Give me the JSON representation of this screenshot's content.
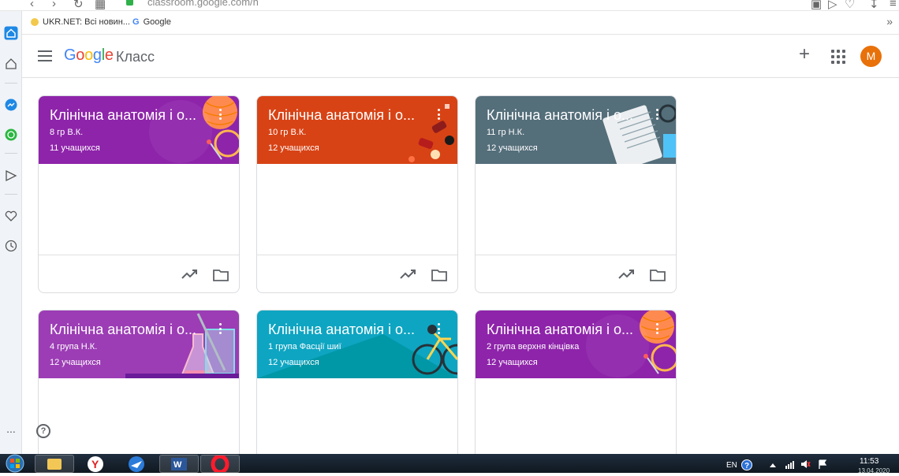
{
  "browser": {
    "url": "classroom.google.com/h",
    "bookmarks": [
      {
        "label": "UKR.NET: Всі новин...",
        "icon": "ukrnet-icon"
      },
      {
        "label": "Google",
        "icon": "google-g-icon"
      }
    ],
    "bookmarks_more": "»"
  },
  "header": {
    "logo_parts": [
      "G",
      "o",
      "o",
      "g",
      "l",
      "e"
    ],
    "app_name": "Класс",
    "avatar_letter": "M",
    "plus_label": "+"
  },
  "courses": [
    {
      "title": "Клінічна анатомія і о...",
      "section": "8 гр В.К.",
      "students": "11 учащихся",
      "color": "#8e24aa",
      "theme": "ball-yarn"
    },
    {
      "title": "Клінічна анатомія і о...",
      "section": "10 гр В.К.",
      "students": "12 учащихся",
      "color": "#d84315",
      "theme": "party"
    },
    {
      "title": "Клінічна анатомія і о...",
      "section": "11 гр Н.К.",
      "students": "12 учащихся",
      "color": "#546e7a",
      "theme": "notebook"
    },
    {
      "title": "Клінічна анатомія і о...",
      "section": "4 група Н.К.",
      "students": "12 учащихся",
      "color": "#9c3db5",
      "theme": "chemistry"
    },
    {
      "title": "Клінічна анатомія і о...",
      "section": "1 група Фасції шиї",
      "students": "12 учащихся",
      "color": "#0ea5c2",
      "theme": "bicycle"
    },
    {
      "title": "Клінічна анатомія і о...",
      "section": "2 група верхня кінцівка",
      "students": "12 учащихся",
      "color": "#8e24aa",
      "theme": "ball-yarn"
    }
  ],
  "help_label": "?",
  "taskbar": {
    "lang": "EN",
    "time": "11:53",
    "date": "13.04.2020"
  },
  "sidebar_more": "..."
}
